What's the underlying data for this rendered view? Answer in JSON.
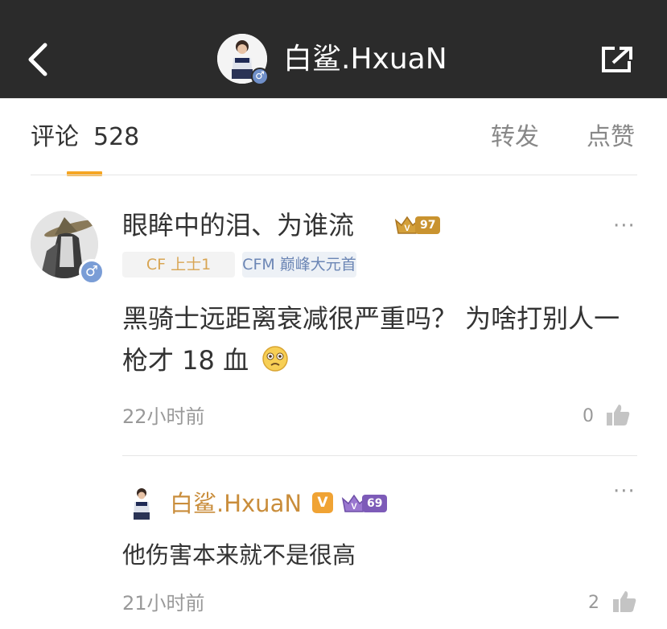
{
  "header": {
    "title": "白鲨.HxuaN",
    "gender_symbol": "♂"
  },
  "tabs": {
    "comments_label": "评论",
    "comments_count": "528",
    "repost_label": "转发",
    "like_label": "点赞"
  },
  "comment": {
    "author": "眼眸中的泪、为谁流",
    "gender_symbol": "♂",
    "level": "97",
    "tags": [
      "CF 上士1",
      "CFM 巅峰大元首"
    ],
    "text": "黑骑士远距离衰减很严重吗？ 为啥打别人一枪才 18 血",
    "time": "22小时前",
    "likes": "0",
    "more": "···"
  },
  "reply": {
    "author": "白鲨.HxuaN",
    "vip": "V",
    "level": "69",
    "text": "他伤害本来就不是很高",
    "time": "21小时前",
    "likes": "2",
    "more": "···"
  },
  "colors": {
    "topbar": "#2b2b2b",
    "accent": "#f5a623",
    "reply_name": "#c98d3b",
    "level_gold": "#c9932f",
    "level_purple": "#7d5bb8"
  },
  "icons": [
    "back-arrow-icon",
    "share-icon",
    "more-icon",
    "thumbs-up-icon",
    "emoji-icon",
    "crown-icon"
  ]
}
